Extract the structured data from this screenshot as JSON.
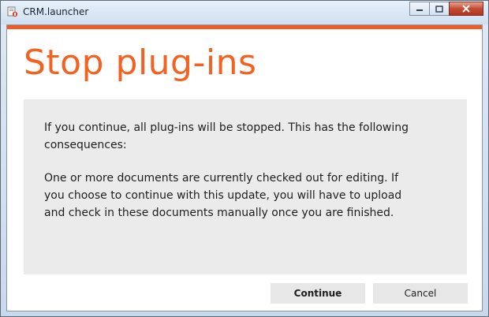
{
  "window": {
    "title": "CRM.launcher",
    "accent_color": "#f25c24"
  },
  "caption_buttons": [
    "minimize-icon",
    "maximize-icon",
    "close-icon"
  ],
  "page": {
    "title": "Stop plug-ins",
    "paragraph1": "If you continue, all plug-ins will be stopped. This has the following consequences:",
    "paragraph2": "One or more documents are currently checked out for editing. If you choose to continue with this update, you will have to upload and check in these documents manually once you are finished."
  },
  "buttons": {
    "continue_label": "Continue",
    "cancel_label": "Cancel"
  }
}
